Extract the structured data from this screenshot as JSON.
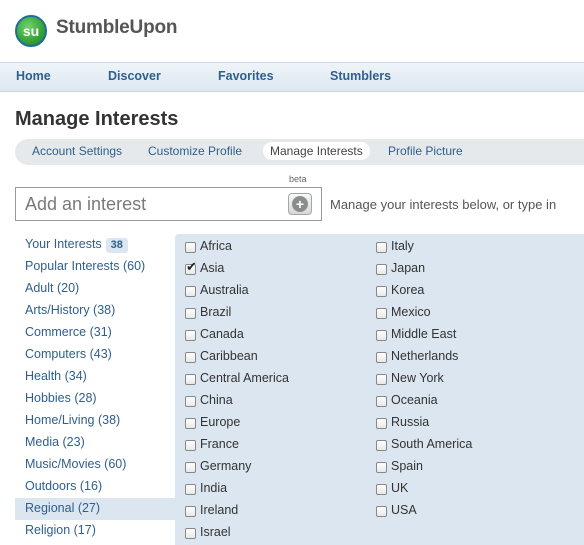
{
  "brand": {
    "logo_glyph": "su",
    "name": "StumbleUpon"
  },
  "nav": [
    "Home",
    "Discover",
    "Favorites",
    "Stumblers"
  ],
  "page_title": "Manage Interests",
  "subnav": {
    "items": [
      "Account Settings",
      "Customize Profile",
      "Manage Interests",
      "Profile Picture"
    ],
    "active": "Manage Interests"
  },
  "add_interest": {
    "placeholder": "Add an interest",
    "beta": "beta",
    "button_icon": "plus-circle-icon",
    "hint": "Manage your interests below, or type in"
  },
  "sidebar": {
    "your_interests": {
      "label": "Your Interests",
      "count": "38"
    },
    "categories": [
      "Popular Interests (60)",
      "Adult (20)",
      "Arts/History (38)",
      "Commerce (31)",
      "Computers (43)",
      "Health (34)",
      "Hobbies (28)",
      "Home/Living (38)",
      "Media (23)",
      "Music/Movies (60)",
      "Outdoors (16)",
      "Regional (27)",
      "Religion (17)"
    ],
    "selected": "Regional (27)"
  },
  "interests": {
    "left": [
      {
        "label": "Africa",
        "checked": false
      },
      {
        "label": "Asia",
        "checked": true
      },
      {
        "label": "Australia",
        "checked": false
      },
      {
        "label": "Brazil",
        "checked": false
      },
      {
        "label": "Canada",
        "checked": false
      },
      {
        "label": "Caribbean",
        "checked": false
      },
      {
        "label": "Central America",
        "checked": false
      },
      {
        "label": "China",
        "checked": false
      },
      {
        "label": "Europe",
        "checked": false
      },
      {
        "label": "France",
        "checked": false
      },
      {
        "label": "Germany",
        "checked": false
      },
      {
        "label": "India",
        "checked": false
      },
      {
        "label": "Ireland",
        "checked": false
      },
      {
        "label": "Israel",
        "checked": false
      }
    ],
    "right": [
      {
        "label": "Italy",
        "checked": false
      },
      {
        "label": "Japan",
        "checked": false
      },
      {
        "label": "Korea",
        "checked": false
      },
      {
        "label": "Mexico",
        "checked": false
      },
      {
        "label": "Middle East",
        "checked": false
      },
      {
        "label": "Netherlands",
        "checked": false
      },
      {
        "label": "New York",
        "checked": false
      },
      {
        "label": "Oceania",
        "checked": false
      },
      {
        "label": "Russia",
        "checked": false
      },
      {
        "label": "South America",
        "checked": false
      },
      {
        "label": "Spain",
        "checked": false
      },
      {
        "label": "UK",
        "checked": false
      },
      {
        "label": "USA",
        "checked": false
      }
    ]
  },
  "colors": {
    "link": "#2f5f8c",
    "panel": "#dbe6f0",
    "nav_bg": "#e6eef5"
  }
}
